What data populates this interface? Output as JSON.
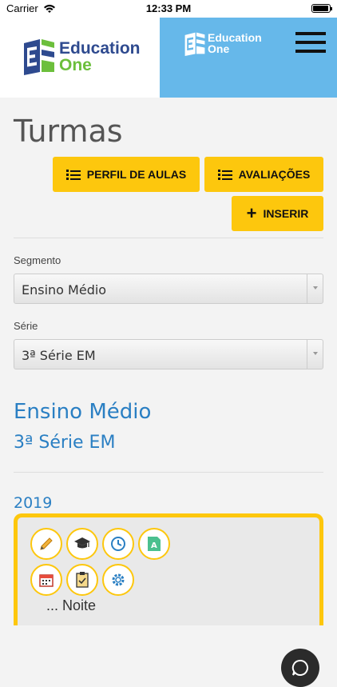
{
  "status_bar": {
    "carrier": "Carrier",
    "time": "12:33 PM"
  },
  "header": {
    "logo_line1": "Education",
    "logo_line2": "One",
    "logo_small_line1": "Education",
    "logo_small_line2": "One",
    "colors": {
      "left_bg": "#ffffff",
      "right_bg": "#66b8ea",
      "logo_blue": "#2e4a8f",
      "logo_green": "#6cbf3c"
    }
  },
  "page": {
    "title": "Turmas",
    "buttons": {
      "perfil": "PERFIL DE AULAS",
      "avaliacoes": "AVALIAÇÕES",
      "inserir": "INSERIR"
    },
    "segmento": {
      "label": "Segmento",
      "value": "Ensino Médio"
    },
    "serie": {
      "label": "Série",
      "value": "3ª Série EM"
    },
    "segment_heading": "Ensino Médio",
    "serie_heading": "3ª Série EM",
    "year": "2019",
    "card": {
      "name": "... Noite",
      "actions": [
        "pencil-icon",
        "graduation-cap-icon",
        "clock-icon",
        "grade-a-icon",
        "calendar-icon",
        "clipboard-check-icon",
        "gear-icon"
      ]
    },
    "accent_color": "#fdc70d",
    "heading_color": "#2a7fc3"
  }
}
